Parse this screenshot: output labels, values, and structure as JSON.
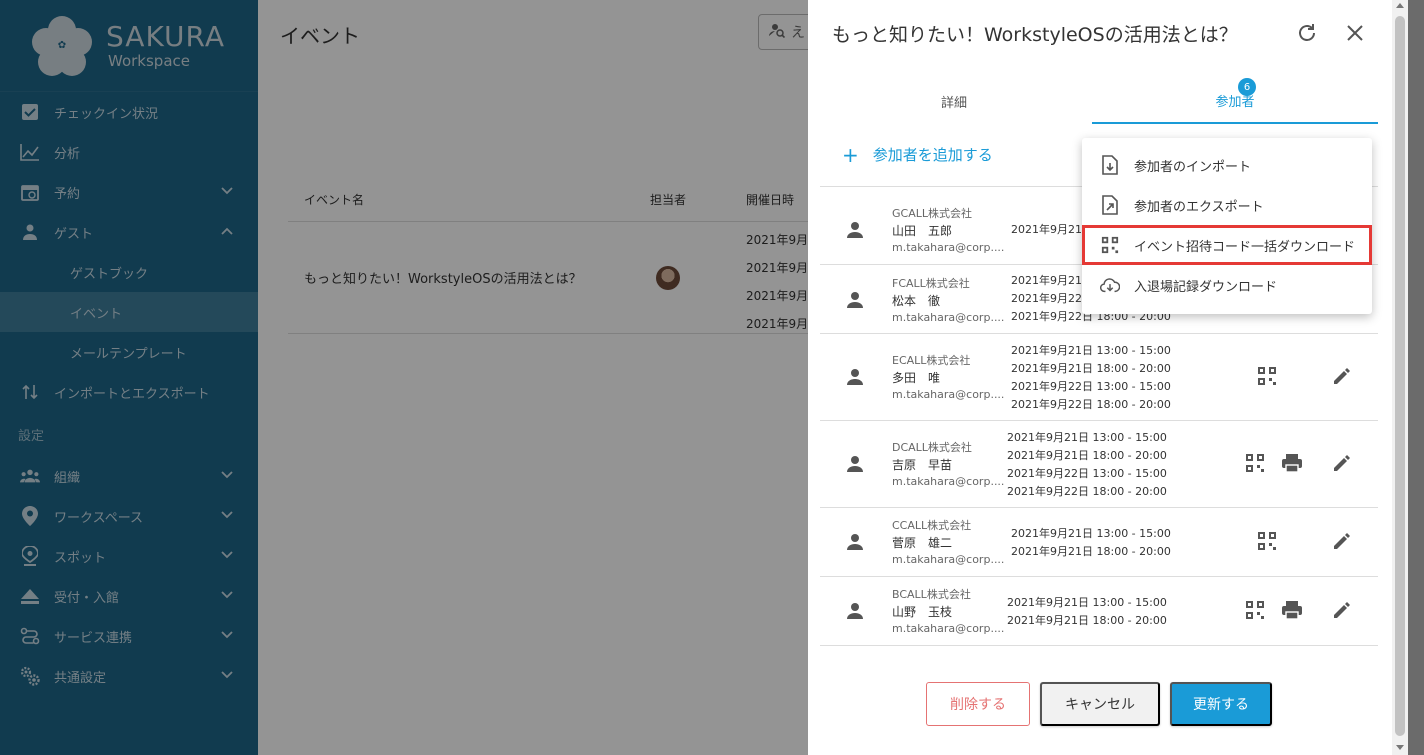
{
  "sidebar": {
    "logo_title": "SAKURA",
    "logo_sub": "Workspace",
    "items": [
      {
        "label": "チェックイン状況"
      },
      {
        "label": "分析"
      },
      {
        "label": "予約"
      },
      {
        "label": "ゲスト"
      },
      {
        "label": "ゲストブック"
      },
      {
        "label": "イベント"
      },
      {
        "label": "メールテンプレート"
      },
      {
        "label": "インポートとエクスポート"
      }
    ],
    "section_label": "設定",
    "settings_items": [
      {
        "label": "組織"
      },
      {
        "label": "ワークスペース"
      },
      {
        "label": "スポット"
      },
      {
        "label": "受付・入館"
      },
      {
        "label": "サービス連携"
      },
      {
        "label": "共通設定"
      }
    ]
  },
  "main": {
    "title": "イベント",
    "search_glyph": "え",
    "columns": [
      "イベント名",
      "担当者",
      "開催日時"
    ],
    "event_name": "もっと知りたい！WorkstyleOSの活用法とは？",
    "event_dates": [
      "2021年9月",
      "2021年9月",
      "2021年9月",
      "2021年9月"
    ]
  },
  "dialog": {
    "title": "もっと知りたい！WorkstyleOSの活用法とは？",
    "tabs": [
      "詳細",
      "参加者"
    ],
    "badge_count": "6",
    "add_label": "参加者を追加する",
    "participants": [
      {
        "company": "GCALL株式会社",
        "name": "山田　五郎",
        "email": "m.takahara@corp....",
        "times": [
          "2021年9月21"
        ]
      },
      {
        "company": "FCALL株式会社",
        "name": "松本　徹",
        "email": "m.takahara@corp....",
        "times": [
          "2021年9月21",
          "2021年9月22",
          "2021年9月22日 18:00 - 20:00"
        ]
      },
      {
        "company": "ECALL株式会社",
        "name": "多田　唯",
        "email": "m.takahara@corp....",
        "times": [
          "2021年9月21日 13:00 - 15:00",
          "2021年9月21日 18:00 - 20:00",
          "2021年9月22日 13:00 - 15:00",
          "2021年9月22日 18:00 - 20:00"
        ]
      },
      {
        "company": "DCALL株式会社",
        "name": "吉原　早苗",
        "email": "m.takahara@corp....",
        "times": [
          "2021年9月21日 13:00 - 15:00",
          "2021年9月21日 18:00 - 20:00",
          "2021年9月22日 13:00 - 15:00",
          "2021年9月22日 18:00 - 20:00"
        ]
      },
      {
        "company": "CCALL株式会社",
        "name": "菅原　雄二",
        "email": "m.takahara@corp....",
        "times": [
          "2021年9月21日 13:00 - 15:00",
          "2021年9月21日 18:00 - 20:00"
        ]
      },
      {
        "company": "BCALL株式会社",
        "name": "山野　玉枝",
        "email": "m.takahara@corp....",
        "times": [
          "2021年9月21日 13:00 - 15:00",
          "2021年9月21日 18:00 - 20:00"
        ]
      }
    ],
    "buttons": {
      "delete": "削除する",
      "cancel": "キャンセル",
      "update": "更新する"
    }
  },
  "menu": {
    "items": [
      "参加者のインポート",
      "参加者のエクスポート",
      "イベント招待コード一括ダウンロード",
      "入退場記録ダウンロード"
    ]
  },
  "colors": {
    "sidebar": "#1e6688",
    "accent": "#1a9bd7",
    "danger": "#e57373",
    "highlight": "#e53935"
  }
}
